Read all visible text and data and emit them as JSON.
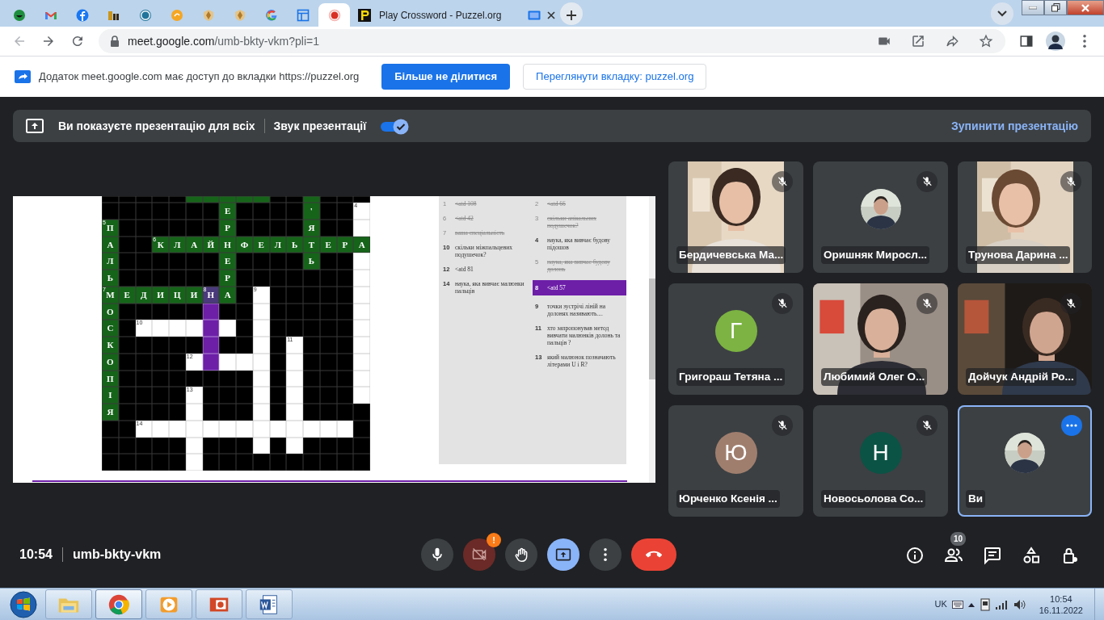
{
  "browser": {
    "tabs": [
      {
        "selected": false
      },
      {
        "selected": false
      },
      {
        "selected": false
      },
      {
        "selected": false
      },
      {
        "selected": false
      },
      {
        "selected": false
      },
      {
        "selected": false
      },
      {
        "selected": false
      },
      {
        "selected": false
      },
      {
        "selected": false
      },
      {
        "selected": true
      },
      {
        "selected": false,
        "title": "Play Crossword - Puzzel.org"
      }
    ],
    "address": {
      "host": "meet.google.com",
      "path": "/umb-bkty-vkm?pli=1"
    }
  },
  "share_infobar": {
    "message": "Додаток meet.google.com має доступ до вкладки https://puzzel.org",
    "primary_button": "Більше не ділитися",
    "secondary_button": "Переглянути вкладку: puzzel.org"
  },
  "presenting_bar": {
    "message": "Ви показуєте презентацію для всіх",
    "audio_label": "Звук презентації",
    "audio_on": true,
    "stop_link": "Зупинити презентацію"
  },
  "crossword": {
    "rows": [
      [
        {
          "kind": "black"
        },
        {
          "kind": "black"
        },
        {
          "kind": "black"
        },
        {
          "kind": "black"
        },
        {
          "kind": "black"
        },
        {
          "kind": "green"
        },
        {
          "kind": "green"
        },
        {
          "kind": "green"
        },
        {
          "kind": "green"
        },
        {
          "kind": "green"
        },
        {
          "kind": "black"
        },
        {
          "kind": "black"
        },
        {
          "kind": "green"
        },
        {
          "kind": "black"
        },
        {
          "kind": "black"
        },
        {
          "kind": "black"
        }
      ],
      [
        {
          "kind": "black"
        },
        {
          "kind": "black"
        },
        {
          "kind": "black"
        },
        {
          "kind": "black"
        },
        {
          "kind": "black"
        },
        {
          "kind": "black"
        },
        {
          "kind": "black"
        },
        {
          "kind": "green",
          "letter": "Е"
        },
        {
          "kind": "black"
        },
        {
          "kind": "black"
        },
        {
          "kind": "black"
        },
        {
          "kind": "black"
        },
        {
          "kind": "green",
          "letter": "'"
        },
        {
          "kind": "black"
        },
        {
          "kind": "black"
        },
        {
          "kind": "white",
          "number": "4"
        }
      ],
      [
        {
          "kind": "green",
          "letter": "П",
          "number": "5"
        },
        {
          "kind": "black"
        },
        {
          "kind": "black"
        },
        {
          "kind": "black"
        },
        {
          "kind": "black"
        },
        {
          "kind": "black"
        },
        {
          "kind": "black"
        },
        {
          "kind": "green",
          "letter": "Р"
        },
        {
          "kind": "black"
        },
        {
          "kind": "black"
        },
        {
          "kind": "black"
        },
        {
          "kind": "black"
        },
        {
          "kind": "green",
          "letter": "Я"
        },
        {
          "kind": "black"
        },
        {
          "kind": "black"
        },
        {
          "kind": "white"
        }
      ],
      [
        {
          "kind": "green",
          "letter": "А"
        },
        {
          "kind": "black"
        },
        {
          "kind": "black"
        },
        {
          "kind": "green",
          "letter": "К",
          "number": "6"
        },
        {
          "kind": "green",
          "letter": "Л"
        },
        {
          "kind": "green",
          "letter": "А"
        },
        {
          "kind": "green",
          "letter": "Й"
        },
        {
          "kind": "green",
          "letter": "Н"
        },
        {
          "kind": "green",
          "letter": "Ф"
        },
        {
          "kind": "green",
          "letter": "Е"
        },
        {
          "kind": "green",
          "letter": "Л"
        },
        {
          "kind": "green",
          "letter": "Ь"
        },
        {
          "kind": "green",
          "letter": "Т"
        },
        {
          "kind": "green",
          "letter": "Е"
        },
        {
          "kind": "green",
          "letter": "Р"
        },
        {
          "kind": "green",
          "letter": "А"
        }
      ],
      [
        {
          "kind": "green",
          "letter": "Л"
        },
        {
          "kind": "black"
        },
        {
          "kind": "black"
        },
        {
          "kind": "black"
        },
        {
          "kind": "black"
        },
        {
          "kind": "black"
        },
        {
          "kind": "black"
        },
        {
          "kind": "green",
          "letter": "Е"
        },
        {
          "kind": "black"
        },
        {
          "kind": "black"
        },
        {
          "kind": "black"
        },
        {
          "kind": "black"
        },
        {
          "kind": "green",
          "letter": "Ь"
        },
        {
          "kind": "black"
        },
        {
          "kind": "black"
        },
        {
          "kind": "white"
        }
      ],
      [
        {
          "kind": "green",
          "letter": "Ь"
        },
        {
          "kind": "black"
        },
        {
          "kind": "black"
        },
        {
          "kind": "black"
        },
        {
          "kind": "black"
        },
        {
          "kind": "black"
        },
        {
          "kind": "black"
        },
        {
          "kind": "green",
          "letter": "Р"
        },
        {
          "kind": "black"
        },
        {
          "kind": "black"
        },
        {
          "kind": "black"
        },
        {
          "kind": "black"
        },
        {
          "kind": "black"
        },
        {
          "kind": "black"
        },
        {
          "kind": "black"
        },
        {
          "kind": "white"
        }
      ],
      [
        {
          "kind": "green",
          "letter": "М",
          "number": "7"
        },
        {
          "kind": "green",
          "letter": "Е"
        },
        {
          "kind": "green",
          "letter": "Д"
        },
        {
          "kind": "green",
          "letter": "И"
        },
        {
          "kind": "green",
          "letter": "Ц"
        },
        {
          "kind": "green",
          "letter": "И"
        },
        {
          "kind": "selected-green",
          "letter": "Н",
          "number": "8"
        },
        {
          "kind": "green",
          "letter": "А"
        },
        {
          "kind": "black"
        },
        {
          "kind": "white",
          "number": "9"
        },
        {
          "kind": "black"
        },
        {
          "kind": "black"
        },
        {
          "kind": "black"
        },
        {
          "kind": "black"
        },
        {
          "kind": "black"
        },
        {
          "kind": "white"
        }
      ],
      [
        {
          "kind": "green",
          "letter": "О"
        },
        {
          "kind": "black"
        },
        {
          "kind": "black"
        },
        {
          "kind": "black"
        },
        {
          "kind": "black"
        },
        {
          "kind": "black"
        },
        {
          "kind": "selected"
        },
        {
          "kind": "black"
        },
        {
          "kind": "black"
        },
        {
          "kind": "white"
        },
        {
          "kind": "black"
        },
        {
          "kind": "black"
        },
        {
          "kind": "black"
        },
        {
          "kind": "black"
        },
        {
          "kind": "black"
        },
        {
          "kind": "white"
        }
      ],
      [
        {
          "kind": "green",
          "letter": "С"
        },
        {
          "kind": "black"
        },
        {
          "kind": "white",
          "number": "10"
        },
        {
          "kind": "white"
        },
        {
          "kind": "white"
        },
        {
          "kind": "white"
        },
        {
          "kind": "selected"
        },
        {
          "kind": "white"
        },
        {
          "kind": "black"
        },
        {
          "kind": "white"
        },
        {
          "kind": "black"
        },
        {
          "kind": "black"
        },
        {
          "kind": "black"
        },
        {
          "kind": "black"
        },
        {
          "kind": "black"
        },
        {
          "kind": "white"
        }
      ],
      [
        {
          "kind": "green",
          "letter": "К"
        },
        {
          "kind": "black"
        },
        {
          "kind": "black"
        },
        {
          "kind": "black"
        },
        {
          "kind": "black"
        },
        {
          "kind": "black"
        },
        {
          "kind": "selected"
        },
        {
          "kind": "black"
        },
        {
          "kind": "black"
        },
        {
          "kind": "white"
        },
        {
          "kind": "black"
        },
        {
          "kind": "white",
          "number": "11"
        },
        {
          "kind": "black"
        },
        {
          "kind": "black"
        },
        {
          "kind": "black"
        },
        {
          "kind": "white"
        }
      ],
      [
        {
          "kind": "green",
          "letter": "О"
        },
        {
          "kind": "black"
        },
        {
          "kind": "black"
        },
        {
          "kind": "black"
        },
        {
          "kind": "black"
        },
        {
          "kind": "white",
          "number": "12"
        },
        {
          "kind": "selected"
        },
        {
          "kind": "white"
        },
        {
          "kind": "white"
        },
        {
          "kind": "white"
        },
        {
          "kind": "black"
        },
        {
          "kind": "white"
        },
        {
          "kind": "black"
        },
        {
          "kind": "black"
        },
        {
          "kind": "black"
        },
        {
          "kind": "white"
        }
      ],
      [
        {
          "kind": "green",
          "letter": "П"
        },
        {
          "kind": "black"
        },
        {
          "kind": "black"
        },
        {
          "kind": "black"
        },
        {
          "kind": "black"
        },
        {
          "kind": "black"
        },
        {
          "kind": "black"
        },
        {
          "kind": "black"
        },
        {
          "kind": "black"
        },
        {
          "kind": "white"
        },
        {
          "kind": "black"
        },
        {
          "kind": "white"
        },
        {
          "kind": "black"
        },
        {
          "kind": "black"
        },
        {
          "kind": "black"
        },
        {
          "kind": "white"
        }
      ],
      [
        {
          "kind": "green",
          "letter": "І"
        },
        {
          "kind": "black"
        },
        {
          "kind": "black"
        },
        {
          "kind": "black"
        },
        {
          "kind": "black"
        },
        {
          "kind": "white",
          "number": "13"
        },
        {
          "kind": "black"
        },
        {
          "kind": "black"
        },
        {
          "kind": "black"
        },
        {
          "kind": "white"
        },
        {
          "kind": "black"
        },
        {
          "kind": "white"
        },
        {
          "kind": "black"
        },
        {
          "kind": "black"
        },
        {
          "kind": "black"
        },
        {
          "kind": "white"
        }
      ],
      [
        {
          "kind": "green",
          "letter": "Я"
        },
        {
          "kind": "black"
        },
        {
          "kind": "black"
        },
        {
          "kind": "black"
        },
        {
          "kind": "black"
        },
        {
          "kind": "white"
        },
        {
          "kind": "black"
        },
        {
          "kind": "black"
        },
        {
          "kind": "black"
        },
        {
          "kind": "white"
        },
        {
          "kind": "black"
        },
        {
          "kind": "white"
        },
        {
          "kind": "black"
        },
        {
          "kind": "black"
        },
        {
          "kind": "black"
        },
        {
          "kind": "black"
        }
      ],
      [
        {
          "kind": "black"
        },
        {
          "kind": "black"
        },
        {
          "kind": "white",
          "number": "14"
        },
        {
          "kind": "white"
        },
        {
          "kind": "white"
        },
        {
          "kind": "white"
        },
        {
          "kind": "white"
        },
        {
          "kind": "white"
        },
        {
          "kind": "white"
        },
        {
          "kind": "white"
        },
        {
          "kind": "white"
        },
        {
          "kind": "white"
        },
        {
          "kind": "white"
        },
        {
          "kind": "white"
        },
        {
          "kind": "white"
        },
        {
          "kind": "black"
        }
      ],
      [
        {
          "kind": "black"
        },
        {
          "kind": "black"
        },
        {
          "kind": "black"
        },
        {
          "kind": "black"
        },
        {
          "kind": "black"
        },
        {
          "kind": "white"
        },
        {
          "kind": "black"
        },
        {
          "kind": "black"
        },
        {
          "kind": "black"
        },
        {
          "kind": "white"
        },
        {
          "kind": "black"
        },
        {
          "kind": "white"
        },
        {
          "kind": "black"
        },
        {
          "kind": "black"
        },
        {
          "kind": "black"
        },
        {
          "kind": "black"
        }
      ],
      [
        {
          "kind": "black"
        },
        {
          "kind": "black"
        },
        {
          "kind": "black"
        },
        {
          "kind": "black"
        },
        {
          "kind": "black"
        },
        {
          "kind": "white"
        },
        {
          "kind": "black"
        },
        {
          "kind": "black"
        },
        {
          "kind": "black"
        },
        {
          "kind": "black"
        },
        {
          "kind": "black"
        },
        {
          "kind": "black"
        },
        {
          "kind": "black"
        },
        {
          "kind": "black"
        },
        {
          "kind": "black"
        },
        {
          "kind": "black"
        }
      ]
    ],
    "clues": {
      "left": [
        {
          "number": "1",
          "text": "<atd 108",
          "done": true,
          "selected": false
        },
        {
          "number": "6",
          "text": "<atd 42",
          "done": true,
          "selected": false
        },
        {
          "number": "7",
          "text": "ваша спеціальність",
          "done": true,
          "selected": false
        },
        {
          "number": "10",
          "text": "скільки міжпальцевих подушечок?",
          "done": false,
          "selected": false
        },
        {
          "number": "12",
          "text": "<atd 81",
          "done": false,
          "selected": false
        },
        {
          "number": "14",
          "text": "наука, яка вивчає малюнки пальців",
          "done": false,
          "selected": false
        }
      ],
      "right": [
        {
          "number": "2",
          "text": "<atd 66",
          "done": true,
          "selected": false
        },
        {
          "number": "3",
          "text": "скільки апікальних подушечок?",
          "done": true,
          "selected": false
        },
        {
          "number": "4",
          "text": "наука, яка вивчає будову підошов",
          "done": false,
          "selected": false
        },
        {
          "number": "5",
          "text": "наука, яка вивчає будову долонь",
          "done": true,
          "selected": false
        },
        {
          "number": "8",
          "text": "<atd 57",
          "done": false,
          "selected": true
        },
        {
          "number": "9",
          "text": "точки зустрічі ліній на долонях називають....",
          "done": false,
          "selected": false
        },
        {
          "number": "11",
          "text": "хто запропонував метод вивчати малюнків долонь та пальців ?",
          "done": false,
          "selected": false
        },
        {
          "number": "13",
          "text": "який малюнок позначають літерами U і R?",
          "done": false,
          "selected": false
        }
      ]
    }
  },
  "participants": [
    {
      "name": "Бердичевська Ма...",
      "kind": "portrait",
      "muted": true,
      "selected": false
    },
    {
      "name": "Оришняк Миросл...",
      "muted": true,
      "selected": false
    },
    {
      "name": "Трунова Дарина ...",
      "kind": "portrait",
      "muted": true,
      "selected": false
    },
    {
      "name": "Григораш Тетяна ...",
      "kind": "letter",
      "letter": "Г",
      "color": "#7cb342",
      "muted": true,
      "selected": false
    },
    {
      "name": "Любимий Олег О...",
      "kind": "video",
      "muted": true,
      "selected": false
    },
    {
      "name": "Дойчук Андрій Ро...",
      "kind": "video",
      "muted": true,
      "selected": false
    },
    {
      "name": "Юрченко Ксенія ...",
      "kind": "letter",
      "letter": "Ю",
      "color": "#a07e6e",
      "muted": true,
      "selected": false
    },
    {
      "name": "Новосьолова Со...",
      "kind": "letter",
      "letter": "Н",
      "color": "#0b5345",
      "muted": true,
      "selected": false
    },
    {
      "name": "Ви",
      "muted": false,
      "selected": true
    }
  ],
  "call_bar": {
    "time": "10:54",
    "meeting_code": "umb-bkty-vkm",
    "mic_on": true,
    "camera_on": false,
    "camera_alert": "!",
    "presenting": true,
    "people_count": "10"
  },
  "taskbar": {
    "apps": [
      {
        "selected": false
      },
      {
        "selected": true
      },
      {
        "selected": false
      },
      {
        "selected": false
      },
      {
        "selected": false
      }
    ],
    "language": "UK",
    "time": "10:54",
    "date": "16.11.2022"
  }
}
